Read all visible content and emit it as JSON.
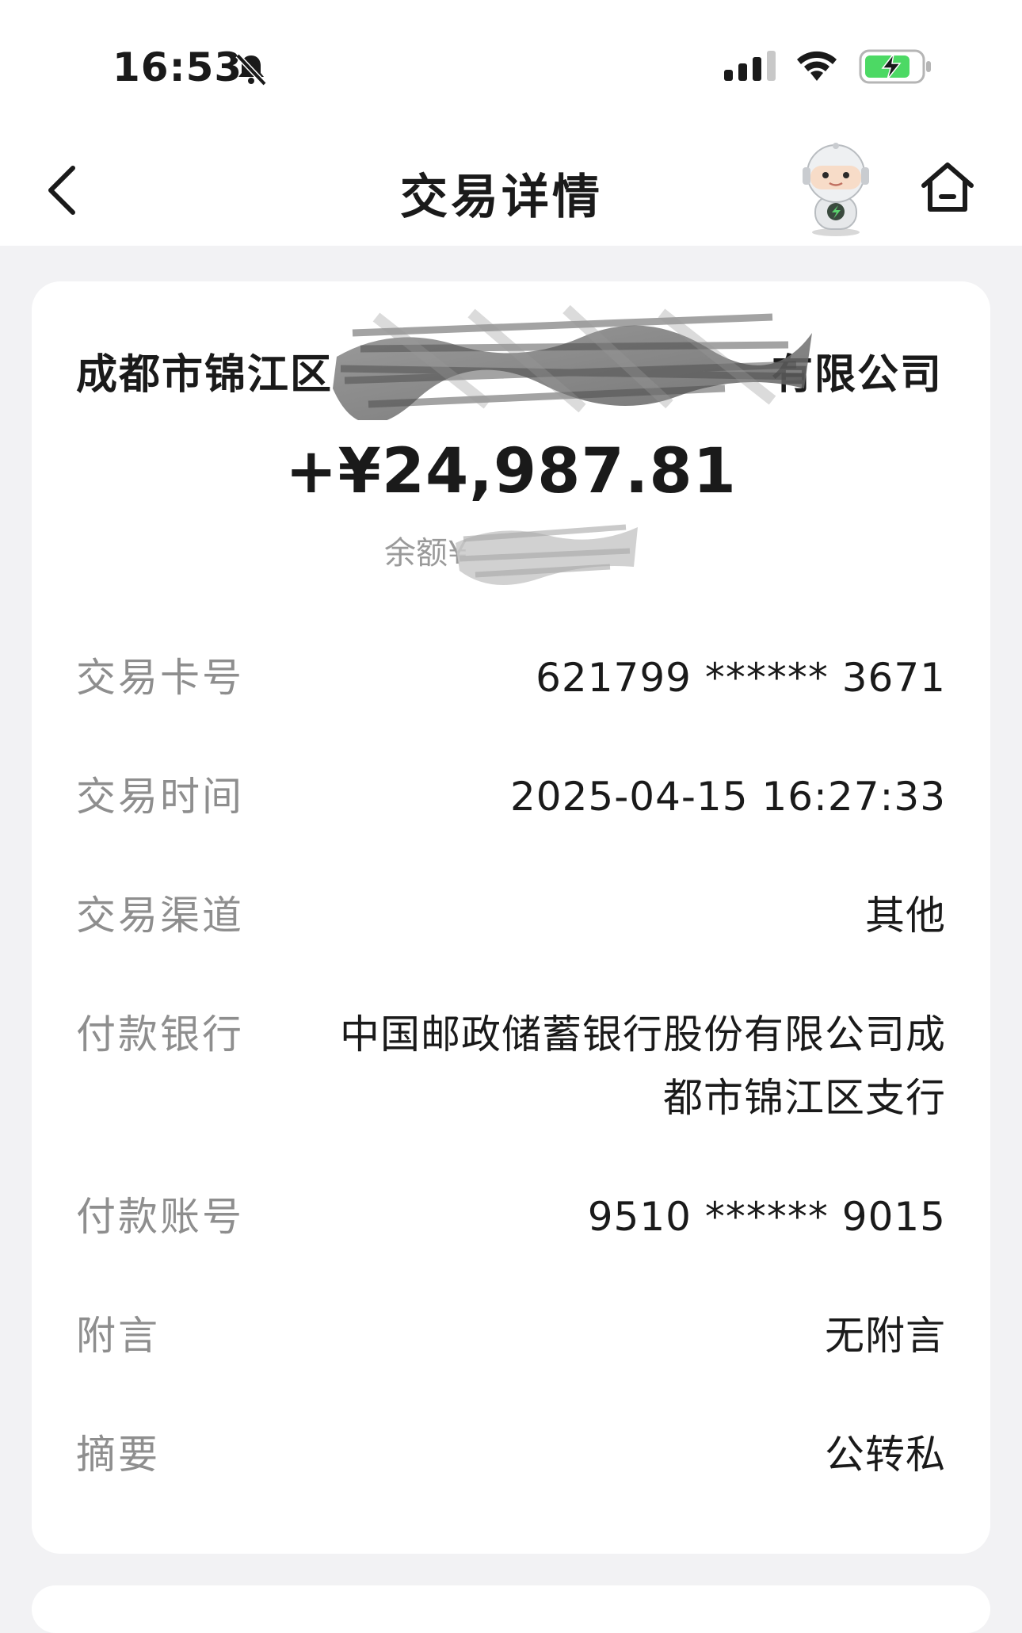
{
  "status_bar": {
    "time": "16:53",
    "bell_icon": "bell-slash-icon",
    "signal_icon": "cellular-signal-icon",
    "wifi_icon": "wifi-icon",
    "battery_icon": "battery-charging-icon",
    "battery_color": "#4cd964"
  },
  "nav": {
    "back_icon": "chevron-left-icon",
    "title": "交易详情",
    "assistant_icon": "robot-assistant-icon",
    "home_icon": "home-icon"
  },
  "transaction": {
    "payee_prefix": "成都市锦江区",
    "payee_suffix": "有限公司",
    "amount": "+¥24,987.81",
    "balance_label": "余额¥"
  },
  "details": [
    {
      "label": "交易卡号",
      "value": "621799 ****** 3671"
    },
    {
      "label": "交易时间",
      "value": "2025-04-15 16:27:33"
    },
    {
      "label": "交易渠道",
      "value": "其他"
    },
    {
      "label": "付款银行",
      "value": "中国邮政储蓄银行股份有限公司成都市锦江区支行"
    },
    {
      "label": "付款账号",
      "value": "9510 ****** 9015"
    },
    {
      "label": "附言",
      "value": "无附言"
    },
    {
      "label": "摘要",
      "value": "公转私"
    }
  ]
}
